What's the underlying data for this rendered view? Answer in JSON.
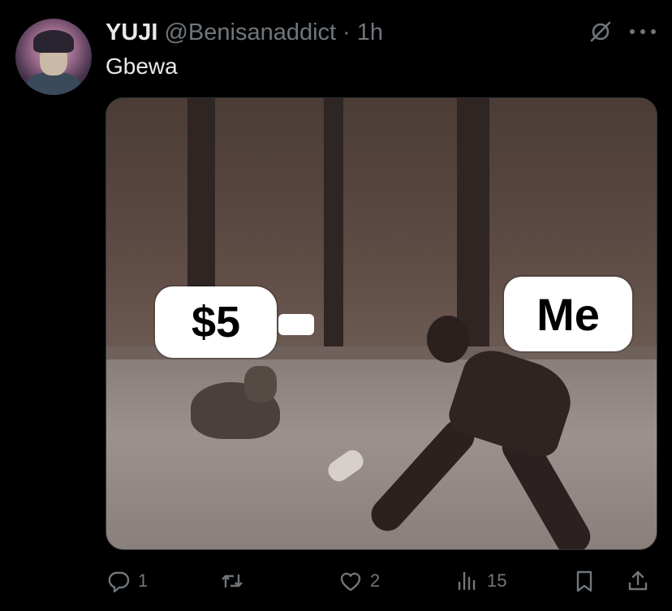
{
  "tweet": {
    "author_name": "YUJI",
    "handle": "@Benisanaddict",
    "separator": "·",
    "time": "1h",
    "text": "Gbewa"
  },
  "media": {
    "label_left": "$5",
    "label_right": "Me"
  },
  "actions": {
    "replies": "1",
    "retweets": "",
    "likes": "2",
    "views": "15"
  },
  "icons": {
    "mute": "mute-icon",
    "more": "more-icon",
    "reply": "reply-icon",
    "retweet": "retweet-icon",
    "like": "heart-icon",
    "views": "views-icon",
    "bookmark": "bookmark-icon",
    "share": "share-icon"
  },
  "colors": {
    "background": "#000000",
    "text_primary": "#e7e9ea",
    "text_secondary": "#71767b"
  }
}
